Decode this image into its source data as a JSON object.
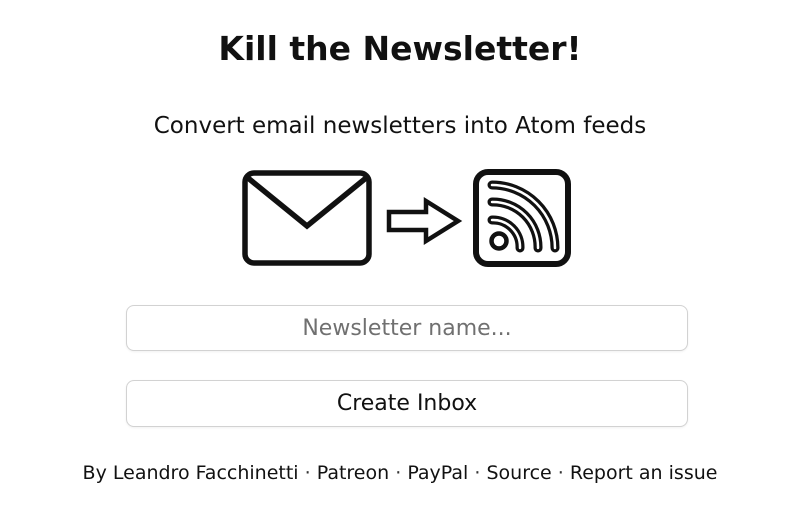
{
  "header": {
    "title": "Kill the Newsletter!",
    "subtitle": "Convert email newsletters into Atom feeds"
  },
  "illustration": {
    "icons": [
      "envelope-icon",
      "arrow-right-icon",
      "rss-feed-icon"
    ],
    "stroke_color": "#111111"
  },
  "form": {
    "name_input": {
      "placeholder": "Newsletter name...",
      "value": ""
    },
    "submit_label": "Create Inbox"
  },
  "footer": {
    "author_prefix": "By",
    "author": "Leandro Facchinetti",
    "separator": "·",
    "links": [
      "Patreon",
      "PayPal",
      "Source",
      "Report an issue"
    ]
  }
}
